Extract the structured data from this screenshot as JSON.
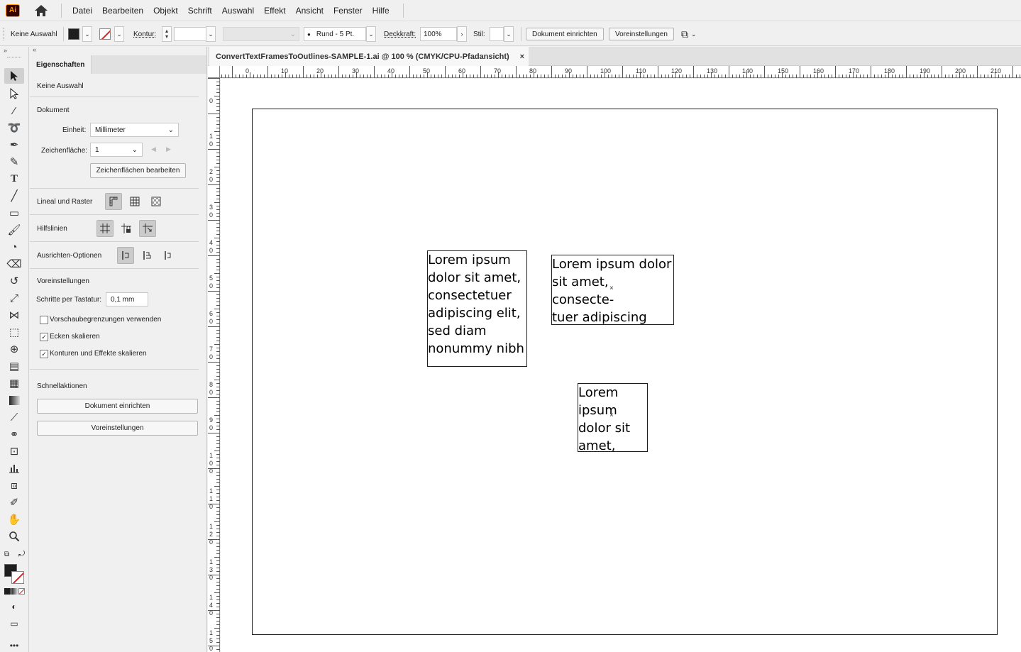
{
  "app": {
    "logo_text": "Ai"
  },
  "menu": [
    "Datei",
    "Bearbeiten",
    "Objekt",
    "Schrift",
    "Auswahl",
    "Effekt",
    "Ansicht",
    "Fenster",
    "Hilfe"
  ],
  "control": {
    "selection_label": "Keine Auswahl",
    "kontur_label": "Kontur:",
    "brush": "Rund - 5 Pt.",
    "deckkraft_label": "Deckkraft:",
    "deckkraft_value": "100%",
    "stil_label": "Stil:",
    "btn_document_setup": "Dokument einrichten",
    "btn_preferences": "Voreinstellungen"
  },
  "document": {
    "tab_title": "ConvertTextFramesToOutlines-SAMPLE-1.ai @ 100 % (CMYK/CPU-Pfadansicht)",
    "close": "×"
  },
  "panel": {
    "tab": "Eigenschaften",
    "selection": "Keine Auswahl",
    "doc_section": "Dokument",
    "unit_label": "Einheit:",
    "unit_value": "Millimeter",
    "artboard_label": "Zeichenfläche:",
    "artboard_value": "1",
    "edit_artboards": "Zeichenflächen bearbeiten",
    "rulers_section": "Lineal und Raster",
    "guides_section": "Hilfslinien",
    "align_section": "Ausrichten-Optionen",
    "prefs_section": "Voreinstellungen",
    "keyboard_label": "Schritte per Tastatur:",
    "keyboard_value": "0,1 mm",
    "chk_preview_bounds": "Vorschaubegrenzungen verwenden",
    "chk_preview_bounds_checked": false,
    "chk_scale_corners": "Ecken skalieren",
    "chk_scale_corners_checked": true,
    "chk_scale_strokes": "Konturen und Effekte skalieren",
    "chk_scale_strokes_checked": true,
    "quick_section": "Schnellaktionen",
    "quick_doc_setup": "Dokument einrichten",
    "quick_prefs": "Voreinstellungen"
  },
  "ruler": {
    "h_labels": [
      "10",
      "0",
      "10",
      "20",
      "30",
      "40",
      "50",
      "60",
      "70",
      "80",
      "90",
      "100",
      "110",
      "120",
      "130",
      "140",
      "150",
      "160",
      "170",
      "180",
      "190",
      "200",
      "210"
    ],
    "v_labels": [
      "0",
      "10",
      "20",
      "30",
      "40",
      "50",
      "60",
      "70",
      "80",
      "90",
      "100",
      "110",
      "120",
      "130",
      "140",
      "150"
    ]
  },
  "text_frames": [
    {
      "text": "Lorem ipsum\ndolor sit amet,\nconsectetuer\nadipiscing elit,\nsed diam\nnonummy nibh"
    },
    {
      "text": "Lorem ipsum dolor\nsit amet, consecte-\ntuer adipiscing elit,\nsed diam"
    },
    {
      "text": "Lorem\nipsum\ndolor sit\namet,"
    }
  ]
}
